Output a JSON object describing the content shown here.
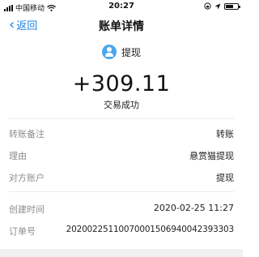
{
  "status_bar": {
    "carrier": "中国移动",
    "time": "20:27"
  },
  "nav": {
    "back_label": "返回",
    "title": "账单详情"
  },
  "summary": {
    "name": "提现",
    "amount": "+309.11",
    "status": "交易成功"
  },
  "details_group1": [
    {
      "label": "转账备注",
      "value": "转账"
    },
    {
      "label": "理由",
      "value": "悬赏猫提现"
    },
    {
      "label": "对方账户",
      "value": "提现"
    }
  ],
  "details_group2": [
    {
      "label": "创建时间",
      "value": "2020-02-25 11:27"
    },
    {
      "label": "订单号",
      "value": "20200225110070001506940042393303"
    }
  ],
  "colors": {
    "accent": "#1a82e0",
    "avatar": "#4aa8ee",
    "label_gray": "#8c8c8c"
  }
}
